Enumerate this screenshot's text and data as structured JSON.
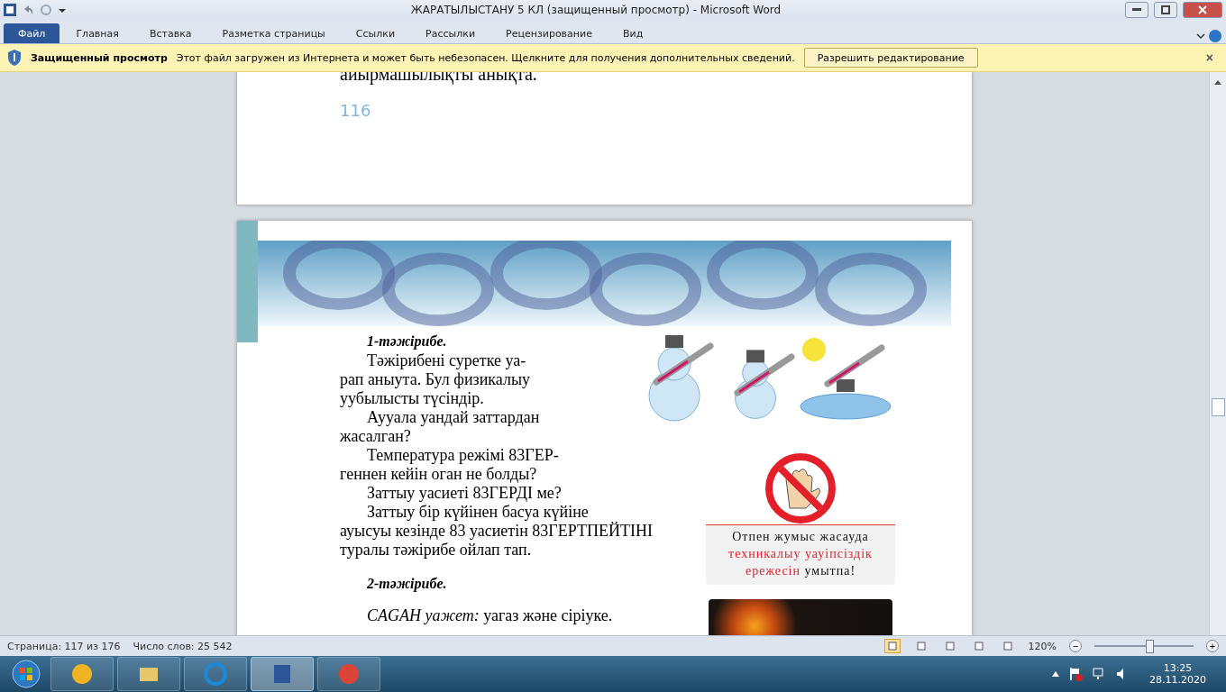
{
  "window": {
    "title": "ЖАРАТЫЛЫСТАНУ 5 КЛ (защищенный просмотр)  -  Microsoft Word"
  },
  "ribbon_tabs": [
    {
      "label": "Файл",
      "selected": true
    },
    {
      "label": "Главная",
      "selected": false
    },
    {
      "label": "Вставка",
      "selected": false
    },
    {
      "label": "Разметка страницы",
      "selected": false
    },
    {
      "label": "Ссылки",
      "selected": false
    },
    {
      "label": "Рассылки",
      "selected": false
    },
    {
      "label": "Рецензирование",
      "selected": false
    },
    {
      "label": "Вид",
      "selected": false
    }
  ],
  "message_bar": {
    "title": "Защищенный просмотр",
    "text": "Этот файл загружен из Интернета и может быть небезопасен. Щелкните для получения дополнительных сведений.",
    "button": "Разрешить редактирование",
    "close": "×"
  },
  "page_one": {
    "last_line": "аиырмашылықты анықта.",
    "page_number": "116"
  },
  "page_two": {
    "experiment_one": {
      "heading": "1-тәжірибе.",
      "paragraphs": [
        [
          "Тәжірибені суретке уа-",
          "рап аныута. Бул физикалыу",
          "уубылысты түсіндір."
        ],
        [
          "Аууала уандай заттардан",
          "жасалган?"
        ],
        [
          "Температура   режімі   83ГЕР-",
          "геннен  кейін оган не болды?"
        ],
        [
          "Заттыу уасиеті 83ГЕРДІ  ме?"
        ],
        [
          "Заттыу бір күйінен басуа күйіне",
          "ауысуы кезінде 83 уасиетін 83ГЕРТПЕЙТІНІ",
          "туралы  тәжірибе ойлап тап."
        ]
      ]
    },
    "experiment_two": {
      "heading": "2-тәжірибе.",
      "materials": "*CAGAH уажет:*  уагаз және сіріуке."
    },
    "caption": [
      {
        "text": "Отпен  жумыс  жасауда ",
        "highlighted": false
      },
      {
        "text": "техникалыу  уауіпсіздік  ережесін",
        "highlighted": true
      },
      {
        "text": "  умытпа!",
        "highlighted": false
      }
    ]
  },
  "status_bar": {
    "page": "Страница: 117 из 176",
    "words": "Число слов: 25 542",
    "views": [
      {
        "selected": true
      },
      {
        "selected": false
      },
      {
        "selected": false
      },
      {
        "selected": false
      },
      {
        "selected": false
      }
    ],
    "zoom": "120%",
    "zoom_out": "−",
    "zoom_in": "+",
    "zoom_level": {
      "level": 0.55
    }
  },
  "taskbar": {
    "apps": [
      {
        "selected": false
      },
      {
        "selected": false
      },
      {
        "selected": false
      },
      {
        "selected": true
      },
      {
        "selected": false
      }
    ],
    "time": "13:25",
    "date": "28.11.2020"
  }
}
